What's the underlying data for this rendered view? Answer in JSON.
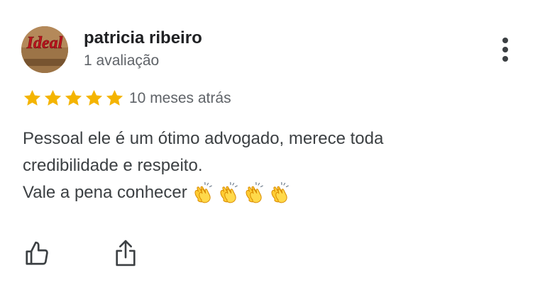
{
  "review": {
    "author_name": "patricia ribeiro",
    "author_review_count": "1 avaliação",
    "avatar_logo_text": "Ideal",
    "rating": 5,
    "rating_max": 5,
    "time_ago": "10 meses atrás",
    "text_lines": [
      "Pessoal ele é um ótimo advogado, merece toda",
      "credibilidade e respeito.",
      "Vale a pena conhecer"
    ],
    "emoji": [
      "👏",
      "👏",
      "👏",
      "👏"
    ],
    "actions": {
      "like_icon": "thumbs-up-icon",
      "share_icon": "share-icon",
      "more_icon": "more-vertical-icon"
    }
  },
  "colors": {
    "star": "#f4b400",
    "name": "#202124",
    "secondary": "#5f6368",
    "body_text": "#3c4043",
    "icon": "#3c4043"
  }
}
